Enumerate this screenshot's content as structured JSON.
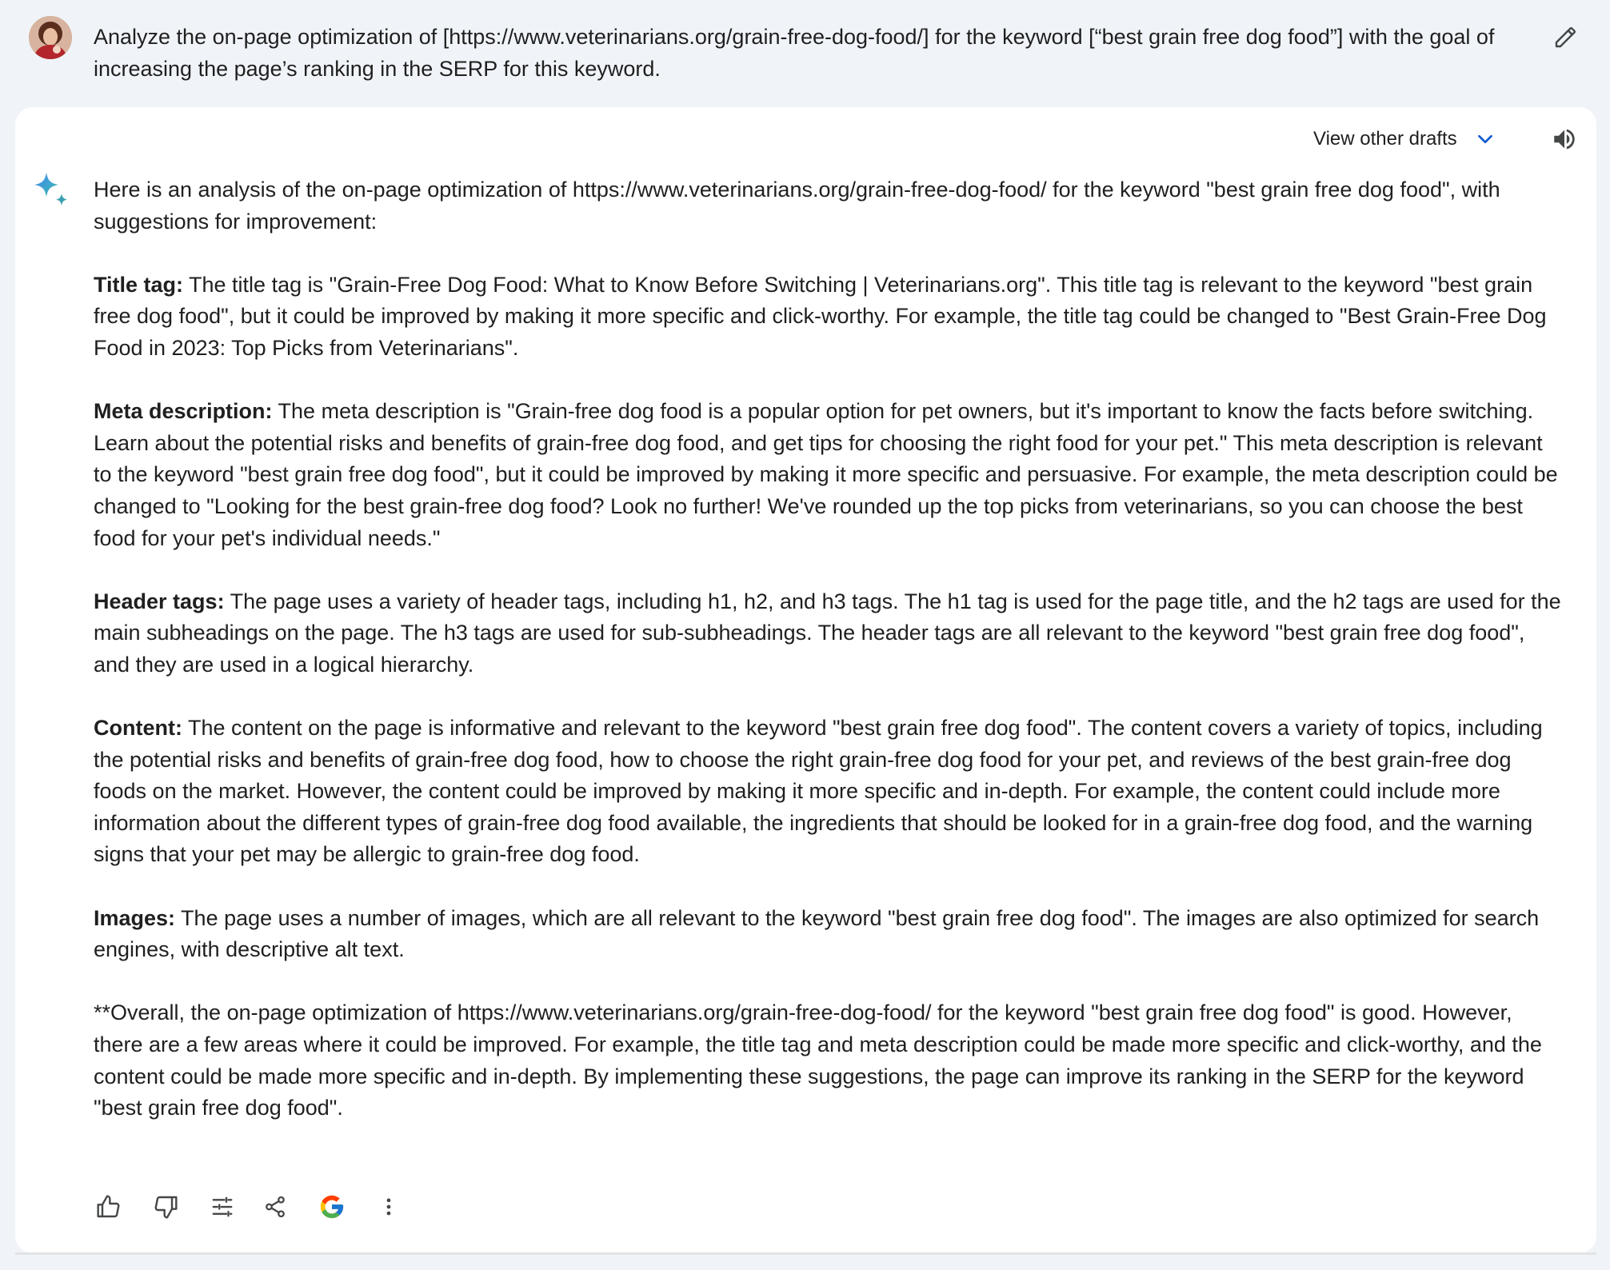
{
  "prompt": {
    "text": "Analyze the on-page optimization of [https://www.veterinarians.org/grain-free-dog-food/] for the keyword [“best grain free dog food”] with the goal of increasing the page’s ranking in the SERP for this keyword."
  },
  "icons": {
    "avatar": "user-avatar",
    "edit": "pencil-icon",
    "drafts_chevron": "chevron-down-icon",
    "speaker": "speaker-icon",
    "assistant": "sparkle-icon",
    "actions": [
      "thumbs-up-icon",
      "thumbs-down-icon",
      "tune-icon",
      "share-icon",
      "google-icon",
      "more-vert-icon"
    ]
  },
  "drafts": {
    "label": "View other drafts"
  },
  "response": {
    "intro": "Here is an analysis of the on-page optimization of https://www.veterinarians.org/grain-free-dog-food/ for the keyword \"best grain free dog food\", with suggestions for improvement:",
    "sections": [
      {
        "heading": "Title tag:",
        "body": " The title tag is \"Grain-Free Dog Food: What to Know Before Switching | Veterinarians.org\". This title tag is relevant to the keyword \"best grain free dog food\", but it could be improved by making it more specific and click-worthy. For example, the title tag could be changed to \"Best Grain-Free Dog Food in 2023: Top Picks from Veterinarians\"."
      },
      {
        "heading": "Meta description:",
        "body": " The meta description is \"Grain-free dog food is a popular option for pet owners, but it's important to know the facts before switching. Learn about the potential risks and benefits of grain-free dog food, and get tips for choosing the right food for your pet.\" This meta description is relevant to the keyword \"best grain free dog food\", but it could be improved by making it more specific and persuasive. For example, the meta description could be changed to \"Looking for the best grain-free dog food? Look no further! We've rounded up the top picks from veterinarians, so you can choose the best food for your pet's individual needs.\""
      },
      {
        "heading": "Header tags:",
        "body": " The page uses a variety of header tags, including h1, h2, and h3 tags. The h1 tag is used for the page title, and the h2 tags are used for the main subheadings on the page. The h3 tags are used for sub-subheadings. The header tags are all relevant to the keyword \"best grain free dog food\", and they are used in a logical hierarchy."
      },
      {
        "heading": "Content:",
        "body": " The content on the page is informative and relevant to the keyword \"best grain free dog food\". The content covers a variety of topics, including the potential risks and benefits of grain-free dog food, how to choose the right grain-free dog food for your pet, and reviews of the best grain-free dog foods on the market. However, the content could be improved by making it more specific and in-depth. For example, the content could include more information about the different types of grain-free dog food available, the ingredients that should be looked for in a grain-free dog food, and the warning signs that your pet may be allergic to grain-free dog food."
      },
      {
        "heading": "Images:",
        "body": " The page uses a number of images, which are all relevant to the keyword \"best grain free dog food\". The images are also optimized for search engines, with descriptive alt text."
      }
    ],
    "overall": "**Overall, the on-page optimization of https://www.veterinarians.org/grain-free-dog-food/ for the keyword \"best grain free dog food\" is good. However, there are a few areas where it could be improved. For example, the title tag and meta description could be made more specific and click-worthy, and the content could be made more specific and in-depth. By implementing these suggestions, the page can improve its ranking in the SERP for the keyword \"best grain free dog food\"."
  }
}
